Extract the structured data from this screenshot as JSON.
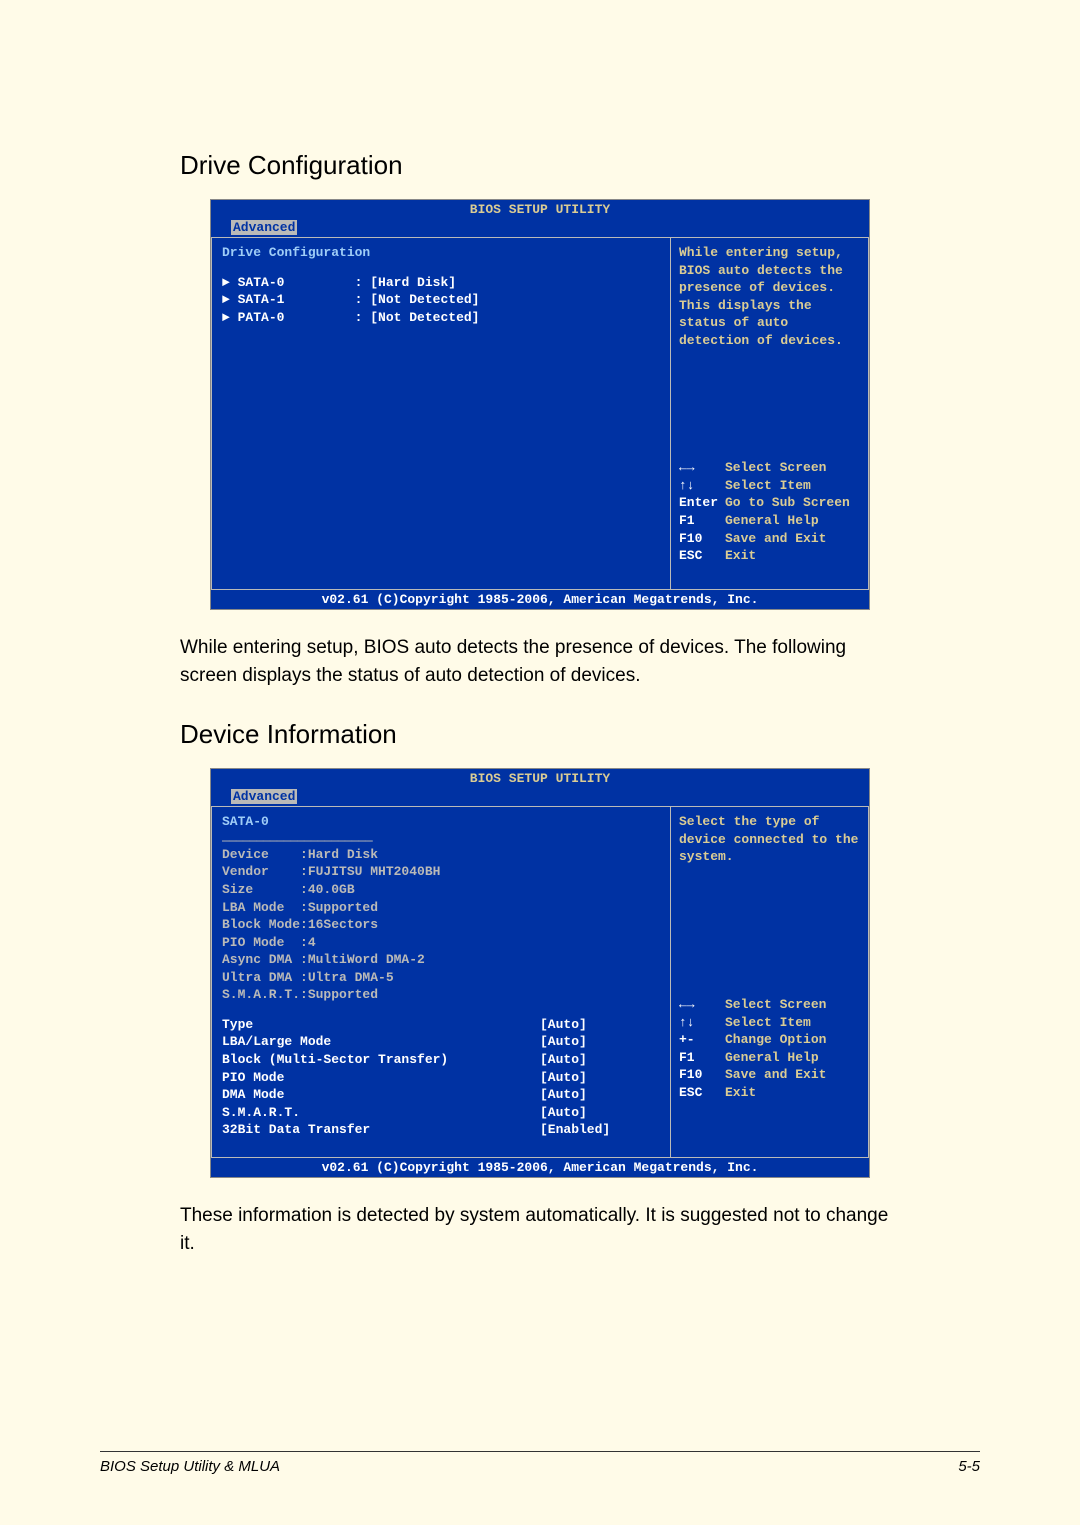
{
  "section1": {
    "heading": "Drive Configuration",
    "bios": {
      "title": "BIOS SETUP UTILITY",
      "tab": "Advanced",
      "panel_title": "Drive Configuration",
      "rows": [
        {
          "label": "SATA-0",
          "value": "[Hard Disk]",
          "white": true
        },
        {
          "label": "SATA-1",
          "value": "[Not Detected]",
          "white": true
        },
        {
          "label": "PATA-0",
          "value": "[Not Detected]",
          "white": true
        }
      ],
      "help_text": "While entering setup, BIOS auto detects the presence of devices. This displays the status of auto detection of devices.",
      "help_keys": [
        {
          "key": "←→",
          "txt": "Select Screen"
        },
        {
          "key": "↑↓",
          "txt": "Select Item"
        },
        {
          "key": "Enter",
          "txt": "Go to Sub Screen"
        },
        {
          "key": "F1",
          "txt": "General Help"
        },
        {
          "key": "F10",
          "txt": "Save and Exit"
        },
        {
          "key": "ESC",
          "txt": "Exit"
        }
      ],
      "footer": "v02.61 (C)Copyright 1985-2006, American Megatrends, Inc."
    },
    "caption": "While entering setup, BIOS auto detects the presence of devices. The following screen displays the status of auto detection of devices."
  },
  "section2": {
    "heading": "Device Information",
    "bios": {
      "title": "BIOS SETUP UTILITY",
      "tab": "Advanced",
      "panel_title": "SATA-0",
      "info": [
        "Device    :Hard Disk",
        "Vendor    :FUJITSU MHT2040BH",
        "Size      :40.0GB",
        "LBA Mode  :Supported",
        "Block Mode:16Sectors",
        "PIO Mode  :4",
        "Async DMA :MultiWord DMA-2",
        "Ultra DMA :Ultra DMA-5",
        "S.M.A.R.T.:Supported"
      ],
      "options": [
        {
          "label": "Type",
          "value": "[Auto]"
        },
        {
          "label": "LBA/Large Mode",
          "value": "[Auto]"
        },
        {
          "label": "Block (Multi-Sector Transfer)",
          "value": "[Auto]"
        },
        {
          "label": "PIO Mode",
          "value": "[Auto]"
        },
        {
          "label": "DMA Mode",
          "value": "[Auto]"
        },
        {
          "label": "S.M.A.R.T.",
          "value": "[Auto]"
        },
        {
          "label": "32Bit Data Transfer",
          "value": "[Enabled]"
        }
      ],
      "help_text": "Select the type of device connected to the system.",
      "help_keys": [
        {
          "key": "←→",
          "txt": "Select Screen"
        },
        {
          "key": "↑↓",
          "txt": "Select Item"
        },
        {
          "key": "+-",
          "txt": "Change Option"
        },
        {
          "key": "F1",
          "txt": "General Help"
        },
        {
          "key": "F10",
          "txt": "Save and Exit"
        },
        {
          "key": "ESC",
          "txt": "Exit"
        }
      ],
      "footer": "v02.61 (C)Copyright 1985-2006, American Megatrends, Inc."
    },
    "caption": "These information is detected by system automatically. It is suggested not to change it."
  },
  "footer": {
    "left": "BIOS Setup Utility & MLUA",
    "right": "5-5"
  }
}
